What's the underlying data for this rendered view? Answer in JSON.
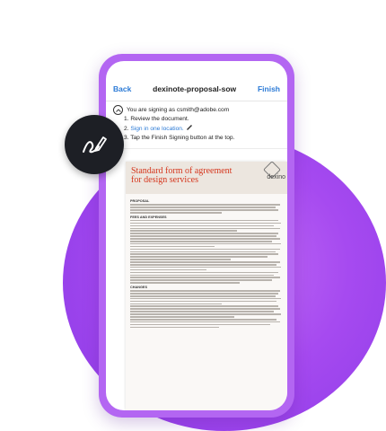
{
  "nav": {
    "back_label": "Back",
    "title": "dexinote-proposal-sow",
    "finish_label": "Finish"
  },
  "instructions": {
    "signing_as": "You are signing as csmith@adobe.com",
    "step1": "1. Review the document.",
    "step2_prefix": "2. ",
    "step2_link": "Sign in one location.",
    "step3": "3. Tap the Finish Signing button at the top."
  },
  "document": {
    "title_line1": "Standard form of agreement",
    "title_line2": "for design services",
    "logo_text": "dexino",
    "sections": [
      "PROPOSAL",
      "FEES AND EXPENSES",
      "CHANGES"
    ]
  },
  "icons": {
    "badge": "signature-pen-icon",
    "chevron": "chevron-up-icon"
  },
  "colors": {
    "accent": "#2b7ad6",
    "purple": "#a64af0",
    "badge_bg": "#1d1f25",
    "doc_title": "#d5361d"
  }
}
